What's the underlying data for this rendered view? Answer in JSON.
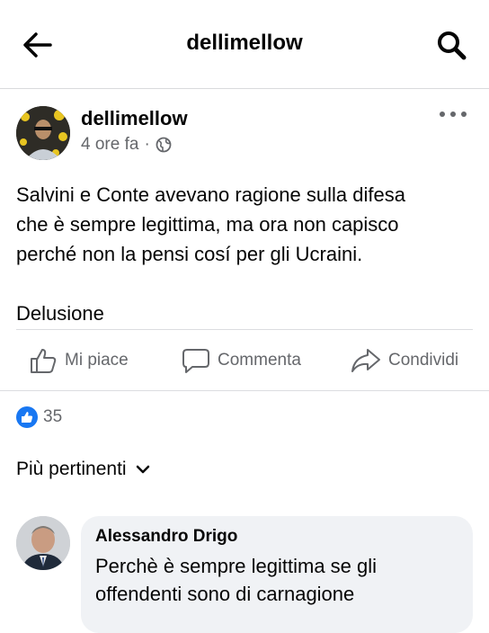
{
  "header": {
    "title": "dellimellow",
    "back_icon": "arrow-left-icon",
    "search_icon": "search-icon"
  },
  "post": {
    "author": "dellimellow",
    "time": "4 ore fa",
    "dot": "·",
    "audience_icon": "globe-icon",
    "text_lines": [
      "Salvini e Conte avevano ragione sulla difesa",
      "che è sempre legittima,  ma ora non capisco",
      "perché non la pensi cosí per gli Ucraini."
    ],
    "text_para2": "Delusione"
  },
  "actions": {
    "like": "Mi piace",
    "comment": "Commenta",
    "share": "Condividi"
  },
  "reactions": {
    "count": "35"
  },
  "comments_sort": {
    "label": "Più pertinenti"
  },
  "comment": {
    "author": "Alessandro Drigo",
    "text_lines": [
      "Perchè è sempre legittima se gli",
      "offendenti sono di carnagione"
    ]
  },
  "colors": {
    "accent": "#1877f2",
    "muted": "#65676b",
    "bubble": "#f0f2f5"
  }
}
